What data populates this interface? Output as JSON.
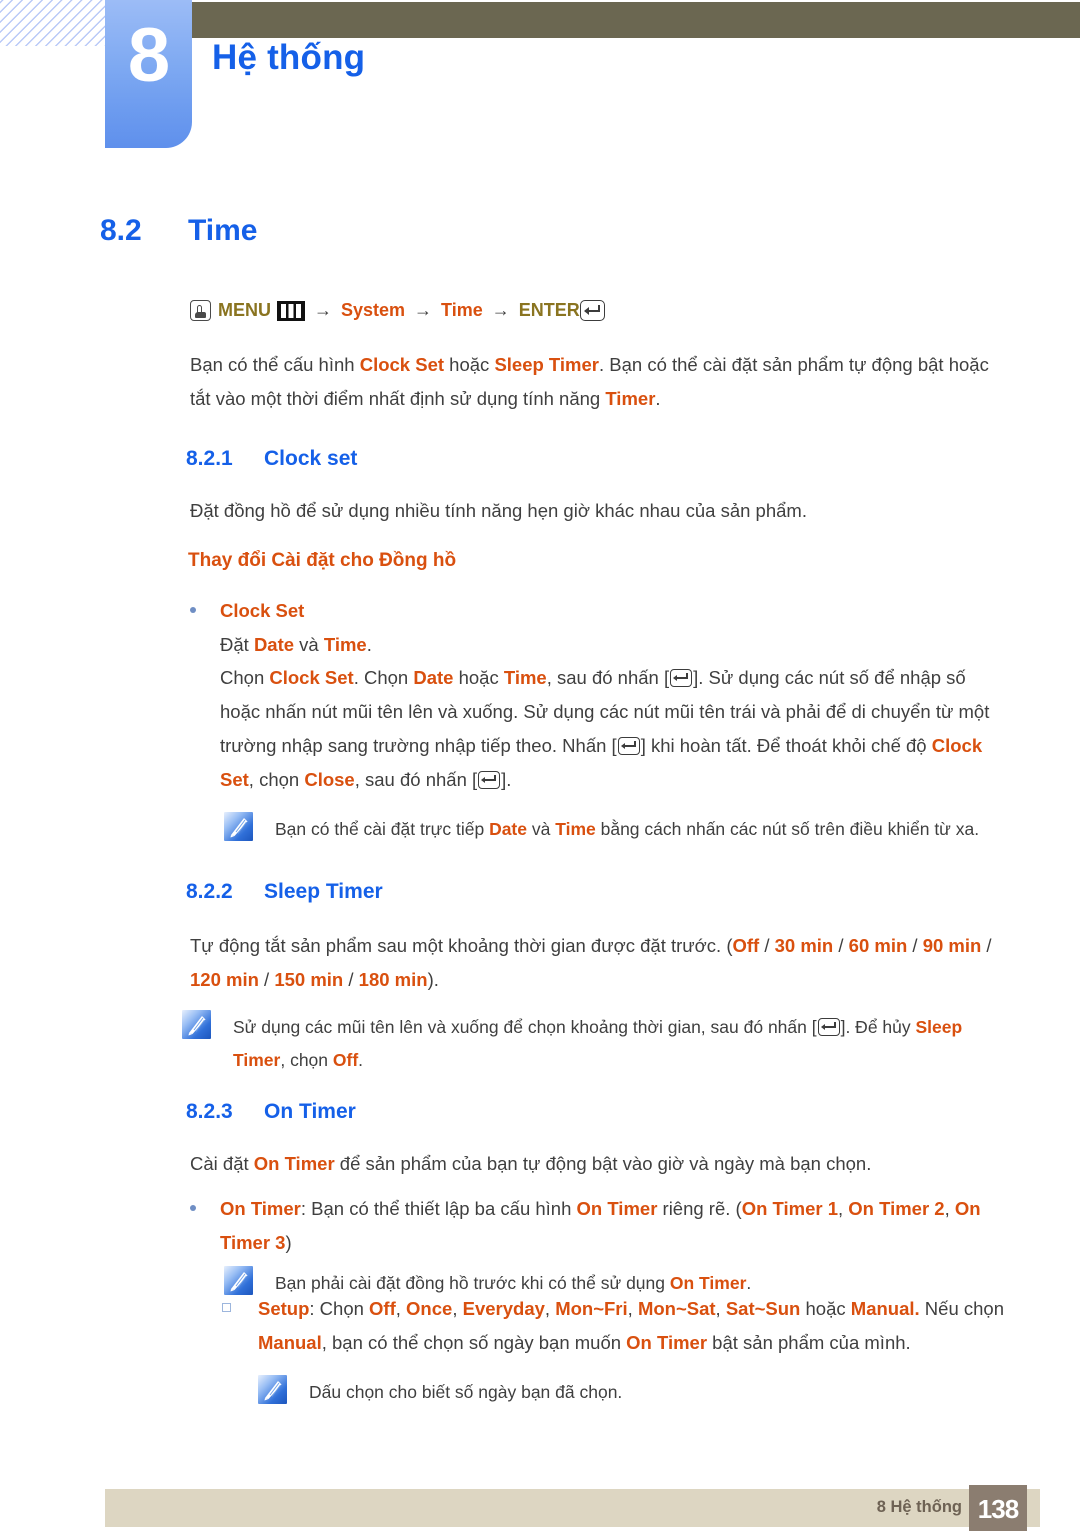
{
  "header": {
    "chapter_number": "8",
    "chapter_title": "Hệ thống"
  },
  "section": {
    "number": "8.2",
    "title": "Time"
  },
  "menu_path": {
    "hand_icon": "hand-press-icon",
    "menu_label": "MENU",
    "menu_bars_icon": "menu-bars-icon",
    "arrow": "→",
    "item1": "System",
    "item2": "Time",
    "enter_label": "ENTER",
    "enter_icon": "enter-key-icon"
  },
  "intro": {
    "t1": "Bạn có thể cấu hình ",
    "b1": "Clock Set",
    "t2": " hoặc ",
    "b2": "Sleep Timer",
    "t3": ". Bạn có thể cài đặt sản phẩm tự động bật hoặc tắt vào một thời điểm nhất định sử dụng tính năng ",
    "b3": "Timer",
    "t4": "."
  },
  "clock_set": {
    "number": "8.2.1",
    "title": "Clock set",
    "description": "Đặt đồng hồ để sử dụng nhiều tính năng hẹn giờ khác nhau của sản phẩm.",
    "subheading": "Thay đổi Cài đặt cho Đồng hồ",
    "bullet_label": "Clock Set",
    "bullet_line": {
      "t1": "Đặt ",
      "b1": "Date",
      "t2": " và ",
      "b2": "Time",
      "t3": "."
    },
    "body": {
      "t1": "Chọn ",
      "b1": "Clock Set",
      "t2": ". Chọn ",
      "b2": "Date",
      "t3": " hoặc ",
      "b3": "Time",
      "t4": ", sau đó nhấn [",
      "t5": "]. Sử dụng các nút số để nhập số hoặc nhấn nút mũi tên lên và xuống. Sử dụng các nút mũi tên trái và phải để di chuyển từ một trường nhập sang trường nhập tiếp theo. Nhấn [",
      "t6": "] khi hoàn tất. Để thoát khỏi chế độ ",
      "b4": "Clock Set",
      "t7": ", chọn ",
      "b5": "Close",
      "t8": ", sau đó nhấn [",
      "t9": "]."
    },
    "note": {
      "icon": "note-quill-icon",
      "t1": "Bạn có thể cài đặt trực tiếp ",
      "b1": "Date",
      "t2": " và ",
      "b2": "Time",
      "t3": " bằng cách nhấn các nút số trên điều khiển từ xa."
    }
  },
  "sleep_timer": {
    "number": "8.2.2",
    "title": "Sleep Timer",
    "body": {
      "t1": "Tự động tắt sản phẩm sau một khoảng thời gian được đặt trước. (",
      "o1": "Off",
      "s1": " / ",
      "o2": "30 min",
      "s2": " / ",
      "o3": "60 min",
      "s3": " / ",
      "o4": "90 min",
      "s4": " / ",
      "o5": "120 min",
      "s5": " / ",
      "o6": "150 min",
      "s6": " / ",
      "o7": "180 min",
      "t2": ")."
    },
    "note": {
      "icon": "note-quill-icon",
      "t1": "Sử dụng các mũi tên lên và xuống để chọn khoảng thời gian, sau đó nhấn [",
      "t2": "]. Để hủy ",
      "b1": "Sleep Timer",
      "t3": ", chọn ",
      "b2": "Off",
      "t4": "."
    }
  },
  "on_timer": {
    "number": "8.2.3",
    "title": "On Timer",
    "description": {
      "t1": "Cài đặt ",
      "b1": "On Timer",
      "t2": " để sản phẩm của bạn tự động bật vào giờ và ngày mà bạn chọn."
    },
    "bullet": {
      "b1": "On Timer",
      "t1": ": Bạn có thể thiết lập ba cấu hình ",
      "b2": "On Timer",
      "t2": " riêng rẽ. (",
      "b3": "On Timer 1",
      "t3": ", ",
      "b4": "On Timer 2",
      "t4": ", ",
      "b5": "On Timer 3",
      "t5": ")"
    },
    "note1": {
      "icon": "note-quill-icon",
      "t1": "Bạn phải cài đặt đồng hồ trước khi có thể sử dụng ",
      "b1": "On Timer",
      "t2": "."
    },
    "setup": {
      "b1": "Setup",
      "t1": ": Chọn ",
      "b2": "Off",
      "t2": ", ",
      "b3": "Once",
      "t3": ", ",
      "b4": "Everyday",
      "t4": ", ",
      "b5": "Mon~Fri",
      "t5": ", ",
      "b6": "Mon~Sat",
      "t6": ", ",
      "b7": "Sat~Sun",
      "t7": " hoặc ",
      "b8": "Manual.",
      "t8": " Nếu chọn ",
      "b9": "Manual",
      "t9": ", bạn có thể chọn số ngày bạn muốn ",
      "b10": "On Timer",
      "t10": " bật sản phẩm của mình."
    },
    "note2": {
      "icon": "note-quill-icon",
      "t1": "Dấu chọn cho biết số ngày bạn đã chọn."
    }
  },
  "footer": {
    "label": "8 Hệ thống",
    "page_number": "138"
  },
  "colors": {
    "heading_blue": "#1560e8",
    "highlight_orange": "#d9500f",
    "menu_gold": "#8a7420",
    "olive_bar": "#6b6751",
    "footer_bar": "#ddd6c2",
    "footer_page_box": "#8b7d70",
    "body_text": "#3f3f3f"
  }
}
